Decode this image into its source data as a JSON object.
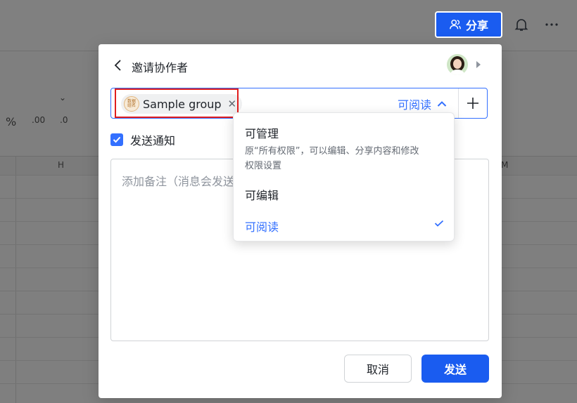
{
  "header": {
    "share_label": "分享",
    "colors": {
      "accent": "#1a5cf0",
      "link": "#3370ff"
    }
  },
  "icons": [
    "users-icon",
    "bell-icon",
    "more-icon"
  ],
  "background": {
    "toolbar": {
      "percent": "%",
      "decimal_increase": ".00",
      "decimal_decrease": ".0"
    },
    "columns": [
      "H",
      "M"
    ]
  },
  "dialog": {
    "title": "邀请协作者",
    "invitee": {
      "name": "Sample group",
      "logo_text": "数据\n组名"
    },
    "permission_current": "可阅读",
    "notify_label": "发送通知",
    "notify_checked": true,
    "note_placeholder": "添加备注（消息会发送",
    "cancel_label": "取消",
    "send_label": "发送"
  },
  "dropdown": {
    "options": [
      {
        "title": "可管理",
        "description": "原“所有权限”，可以编辑、分享内容和修改权限设置",
        "selected": false
      },
      {
        "title": "可编辑",
        "description": "",
        "selected": false
      },
      {
        "title": "可阅读",
        "description": "",
        "selected": true
      }
    ]
  }
}
